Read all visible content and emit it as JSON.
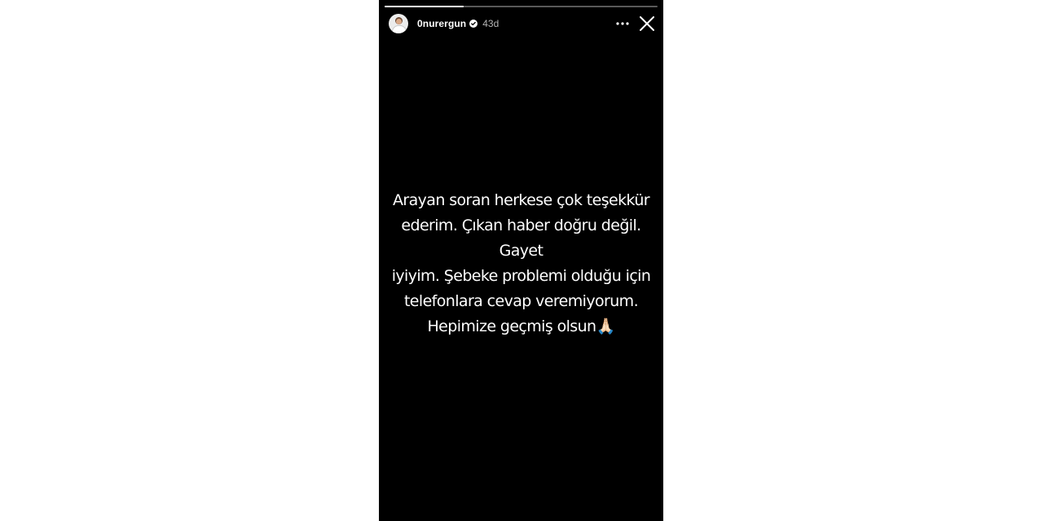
{
  "story": {
    "progress_fraction": 0.29,
    "header": {
      "username": "0nurergun",
      "verified": true,
      "time_ago": "43d",
      "more_icon": "more-horizontal-icon",
      "close_icon": "close-icon"
    },
    "text": "Arayan soran herkese çok teşekkür\nederim. Çıkan haber doğru değil. Gayet\niyiyim. Şebeke problemi olduğu için\ntelefonlara cevap veremiyorum.\nHepimize geçmiş olsun🙏🏻"
  },
  "colors": {
    "page_background": "#ffffff",
    "story_background": "#000000",
    "text": "#ffffff",
    "verified_badge": "#ffffff"
  }
}
